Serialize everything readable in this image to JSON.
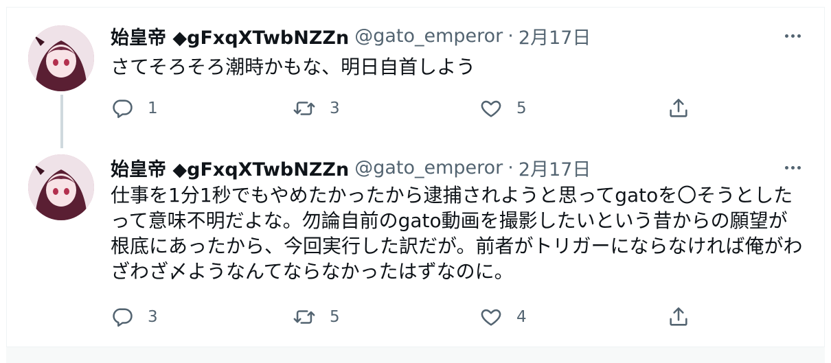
{
  "colors": {
    "text": "#0f1419",
    "muted": "#536471",
    "border": "#eff3f4",
    "thread": "#cfd9de"
  },
  "tweets": [
    {
      "name": "始皇帝 ◆gFxqXTwbNZZn",
      "handle": "@gato_emperor",
      "separator": "·",
      "date": "2月17日",
      "text": "さてそろそろ潮時かもな、明日自首しよう",
      "replies": "1",
      "retweets": "3",
      "likes": "5",
      "icons": {
        "reply": "reply-icon",
        "retweet": "retweet-icon",
        "like": "heart-icon",
        "share": "share-icon",
        "more": "more-dots-icon"
      }
    },
    {
      "name": "始皇帝 ◆gFxqXTwbNZZn",
      "handle": "@gato_emperor",
      "separator": "·",
      "date": "2月17日",
      "text": "仕事を1分1秒でもやめたかったから逮捕されようと思ってgatoを〇そうとしたって意味不明だよな。勿論自前のgato動画を撮影したいという昔からの願望が根底にあったから、今回実行した訳だが。前者がトリガーにならなければ俺がわざわざ〆ようなんてならなかったはずなのに。",
      "replies": "3",
      "retweets": "5",
      "likes": "4",
      "icons": {
        "reply": "reply-icon",
        "retweet": "retweet-icon",
        "like": "heart-icon",
        "share": "share-icon",
        "more": "more-dots-icon"
      }
    }
  ]
}
